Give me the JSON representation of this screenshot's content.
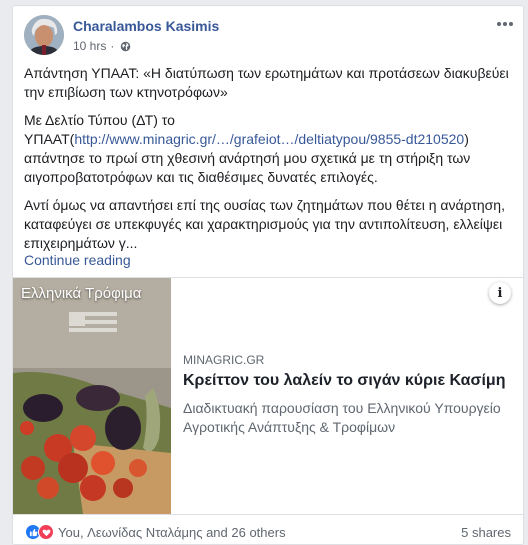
{
  "post": {
    "author": "Charalambos Kasimis",
    "time": "10 hrs",
    "privacy_icon": "globe-icon",
    "menu_icon": "more-dots-icon",
    "paragraph1": "Απάντηση ΥΠΑΑΤ: «Η διατύπωση των ερωτημάτων και προτάσεων διακυβεύει την επιβίωση των κτηνοτρόφων»",
    "paragraph2_before": "Με Δελτίο Τύπου (ΔΤ) το ΥΠΑΑΤ(",
    "paragraph2_link": "http://www.minagric.gr/…/grafeiot…/deltiatypou/9855-dt210520",
    "paragraph2_after": ") απάντησε το πρωί στη χθεσινή ανάρτησή μου σχετικά με τη στήριξη των αιγοπροβατοτρόφων και τις διαθέσιμες δυνατές επιλογές.",
    "paragraph3": "Αντί όμως να απαντήσει επί της ουσίας των ζητημάτων που θέτει η ανάρτηση, καταφεύγει σε υπεκφυγές και χαρακτηρισμούς για την αντιπολίτευση, ελλείψει επιχειρημάτων γ...",
    "continue": "Continue reading"
  },
  "attachment": {
    "thumb_title": "Ελληνικά Τρόφιμα",
    "info_label": "i",
    "domain": "MINAGRIC.GR",
    "title": "Κρείττον του λαλείν το σιγάν κύριε Κασίμη",
    "description": "Διαδικτυακή παρουσίαση του Ελληνικού Υπουργείο Αγροτικής Ανάπτυξης & Τροφίμων"
  },
  "footer": {
    "reactions_text": "You, Λεωνίδας Νταλάμης and 26 others",
    "shares": "5 shares"
  },
  "colors": {
    "link": "#385898",
    "like": "#2078f4",
    "love": "#f33e58"
  }
}
